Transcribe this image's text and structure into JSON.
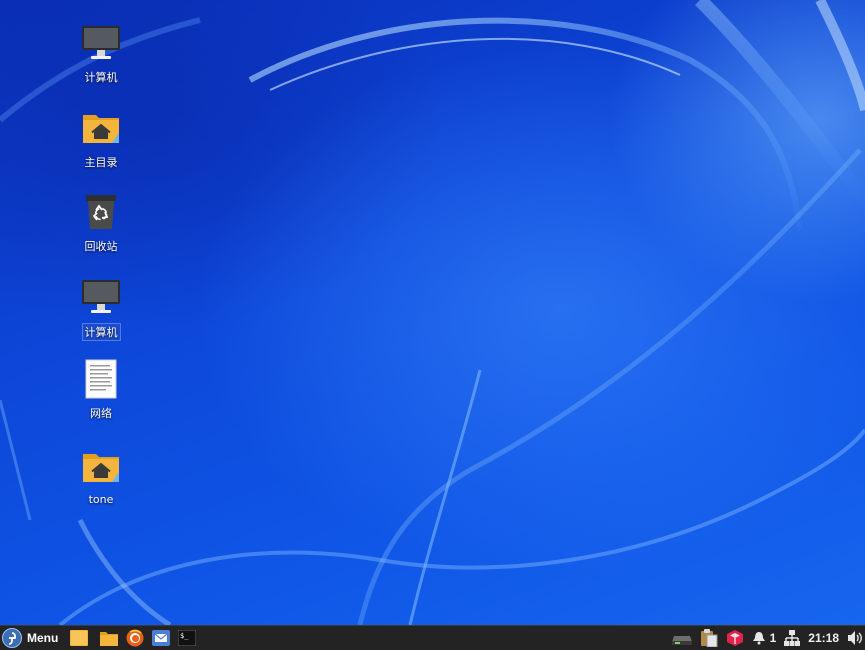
{
  "desktop": {
    "icons": [
      {
        "label": "计算机",
        "icon": "computer-icon"
      },
      {
        "label": "主目录",
        "icon": "home-folder-icon"
      },
      {
        "label": "回收站",
        "icon": "trash-icon"
      },
      {
        "label": "计算机",
        "icon": "computer-icon"
      },
      {
        "label": "网络",
        "icon": "document-icon"
      },
      {
        "label": "tone",
        "icon": "home-folder-icon"
      }
    ]
  },
  "taskbar": {
    "menu_label": "Menu",
    "launchers": [
      {
        "name": "show-desktop",
        "icon": "desktop-icon"
      },
      {
        "name": "files",
        "icon": "folder-icon"
      },
      {
        "name": "firefox",
        "icon": "firefox-icon"
      },
      {
        "name": "mail",
        "icon": "mail-icon"
      },
      {
        "name": "terminal",
        "icon": "terminal-icon"
      }
    ],
    "tray": {
      "notification_count": "1",
      "clock": "21:18"
    }
  },
  "colors": {
    "wallpaper_base": "#0b3fc9",
    "taskbar_bg": "#232323",
    "folder_yellow": "#f3b53b",
    "monitor_gray": "#3d3d3d",
    "firefox_orange": "#e8611a"
  }
}
